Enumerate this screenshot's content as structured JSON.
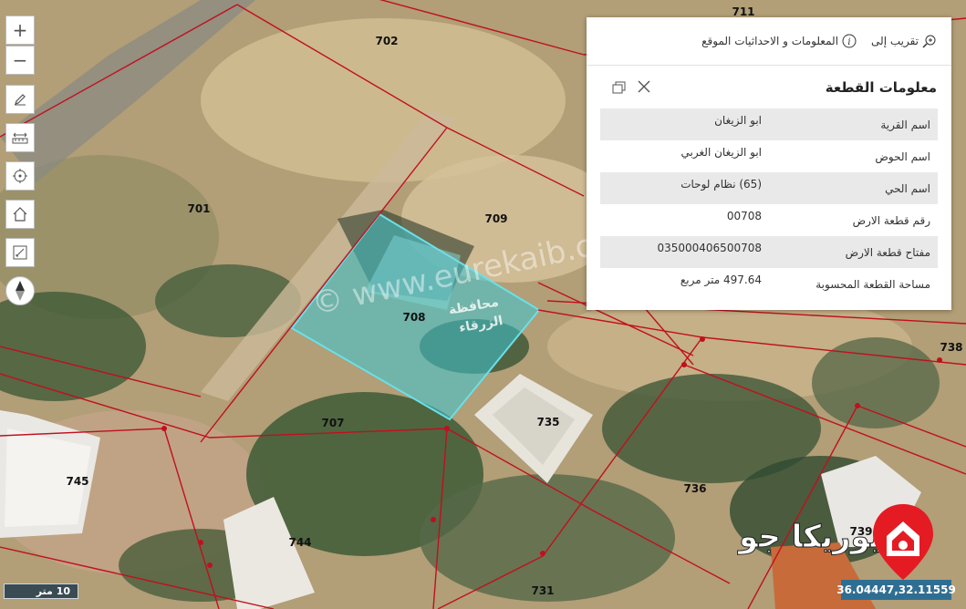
{
  "map": {
    "parcels": {
      "p702": "702",
      "p701": "701",
      "p709": "709",
      "p708": "708",
      "p707": "707",
      "p735": "735",
      "p736": "736",
      "p745": "745",
      "p744": "744",
      "p731": "731",
      "p738": "738",
      "p711": "711",
      "p739": "739"
    },
    "watermark": "© www.eurekaib.com",
    "governorate_label_line1": "محافظة",
    "governorate_label_line2": "الزرقاء",
    "selected_color": "#3cc7d3"
  },
  "toolbar": {
    "zoom_in": "+",
    "zoom_out": "−",
    "tools": [
      "draw-icon",
      "measure-icon",
      "locate-icon",
      "home-icon",
      "edit-map-icon",
      "compass-icon"
    ]
  },
  "panel": {
    "zoom_to_label": "تقريب إلى",
    "info_coords_label": "المعلومات و الاحداثيات الموقع",
    "title": "معلومات القطعة",
    "rows": [
      {
        "label": "اسم القرية",
        "value": "ابو الزيغان"
      },
      {
        "label": "اسم الحوض",
        "value": "ابو الزيغان الغربي"
      },
      {
        "label": "اسم الحي",
        "value": "(65) نظام لوحات"
      },
      {
        "label": "رقم قطعة الارض",
        "value": "00708"
      },
      {
        "label": "مفتاح قطعة الارض",
        "value": "035000406500708"
      },
      {
        "label": "مساحة القطعة المحسوبة",
        "value": "497.64 متر مربع"
      }
    ]
  },
  "scale_label": "10 متر",
  "coordinates": "36.04447,32.11559",
  "logo_text": "يوريكا جو",
  "colors": {
    "boundary": "#c0101e",
    "logo_red": "#e41b23"
  }
}
